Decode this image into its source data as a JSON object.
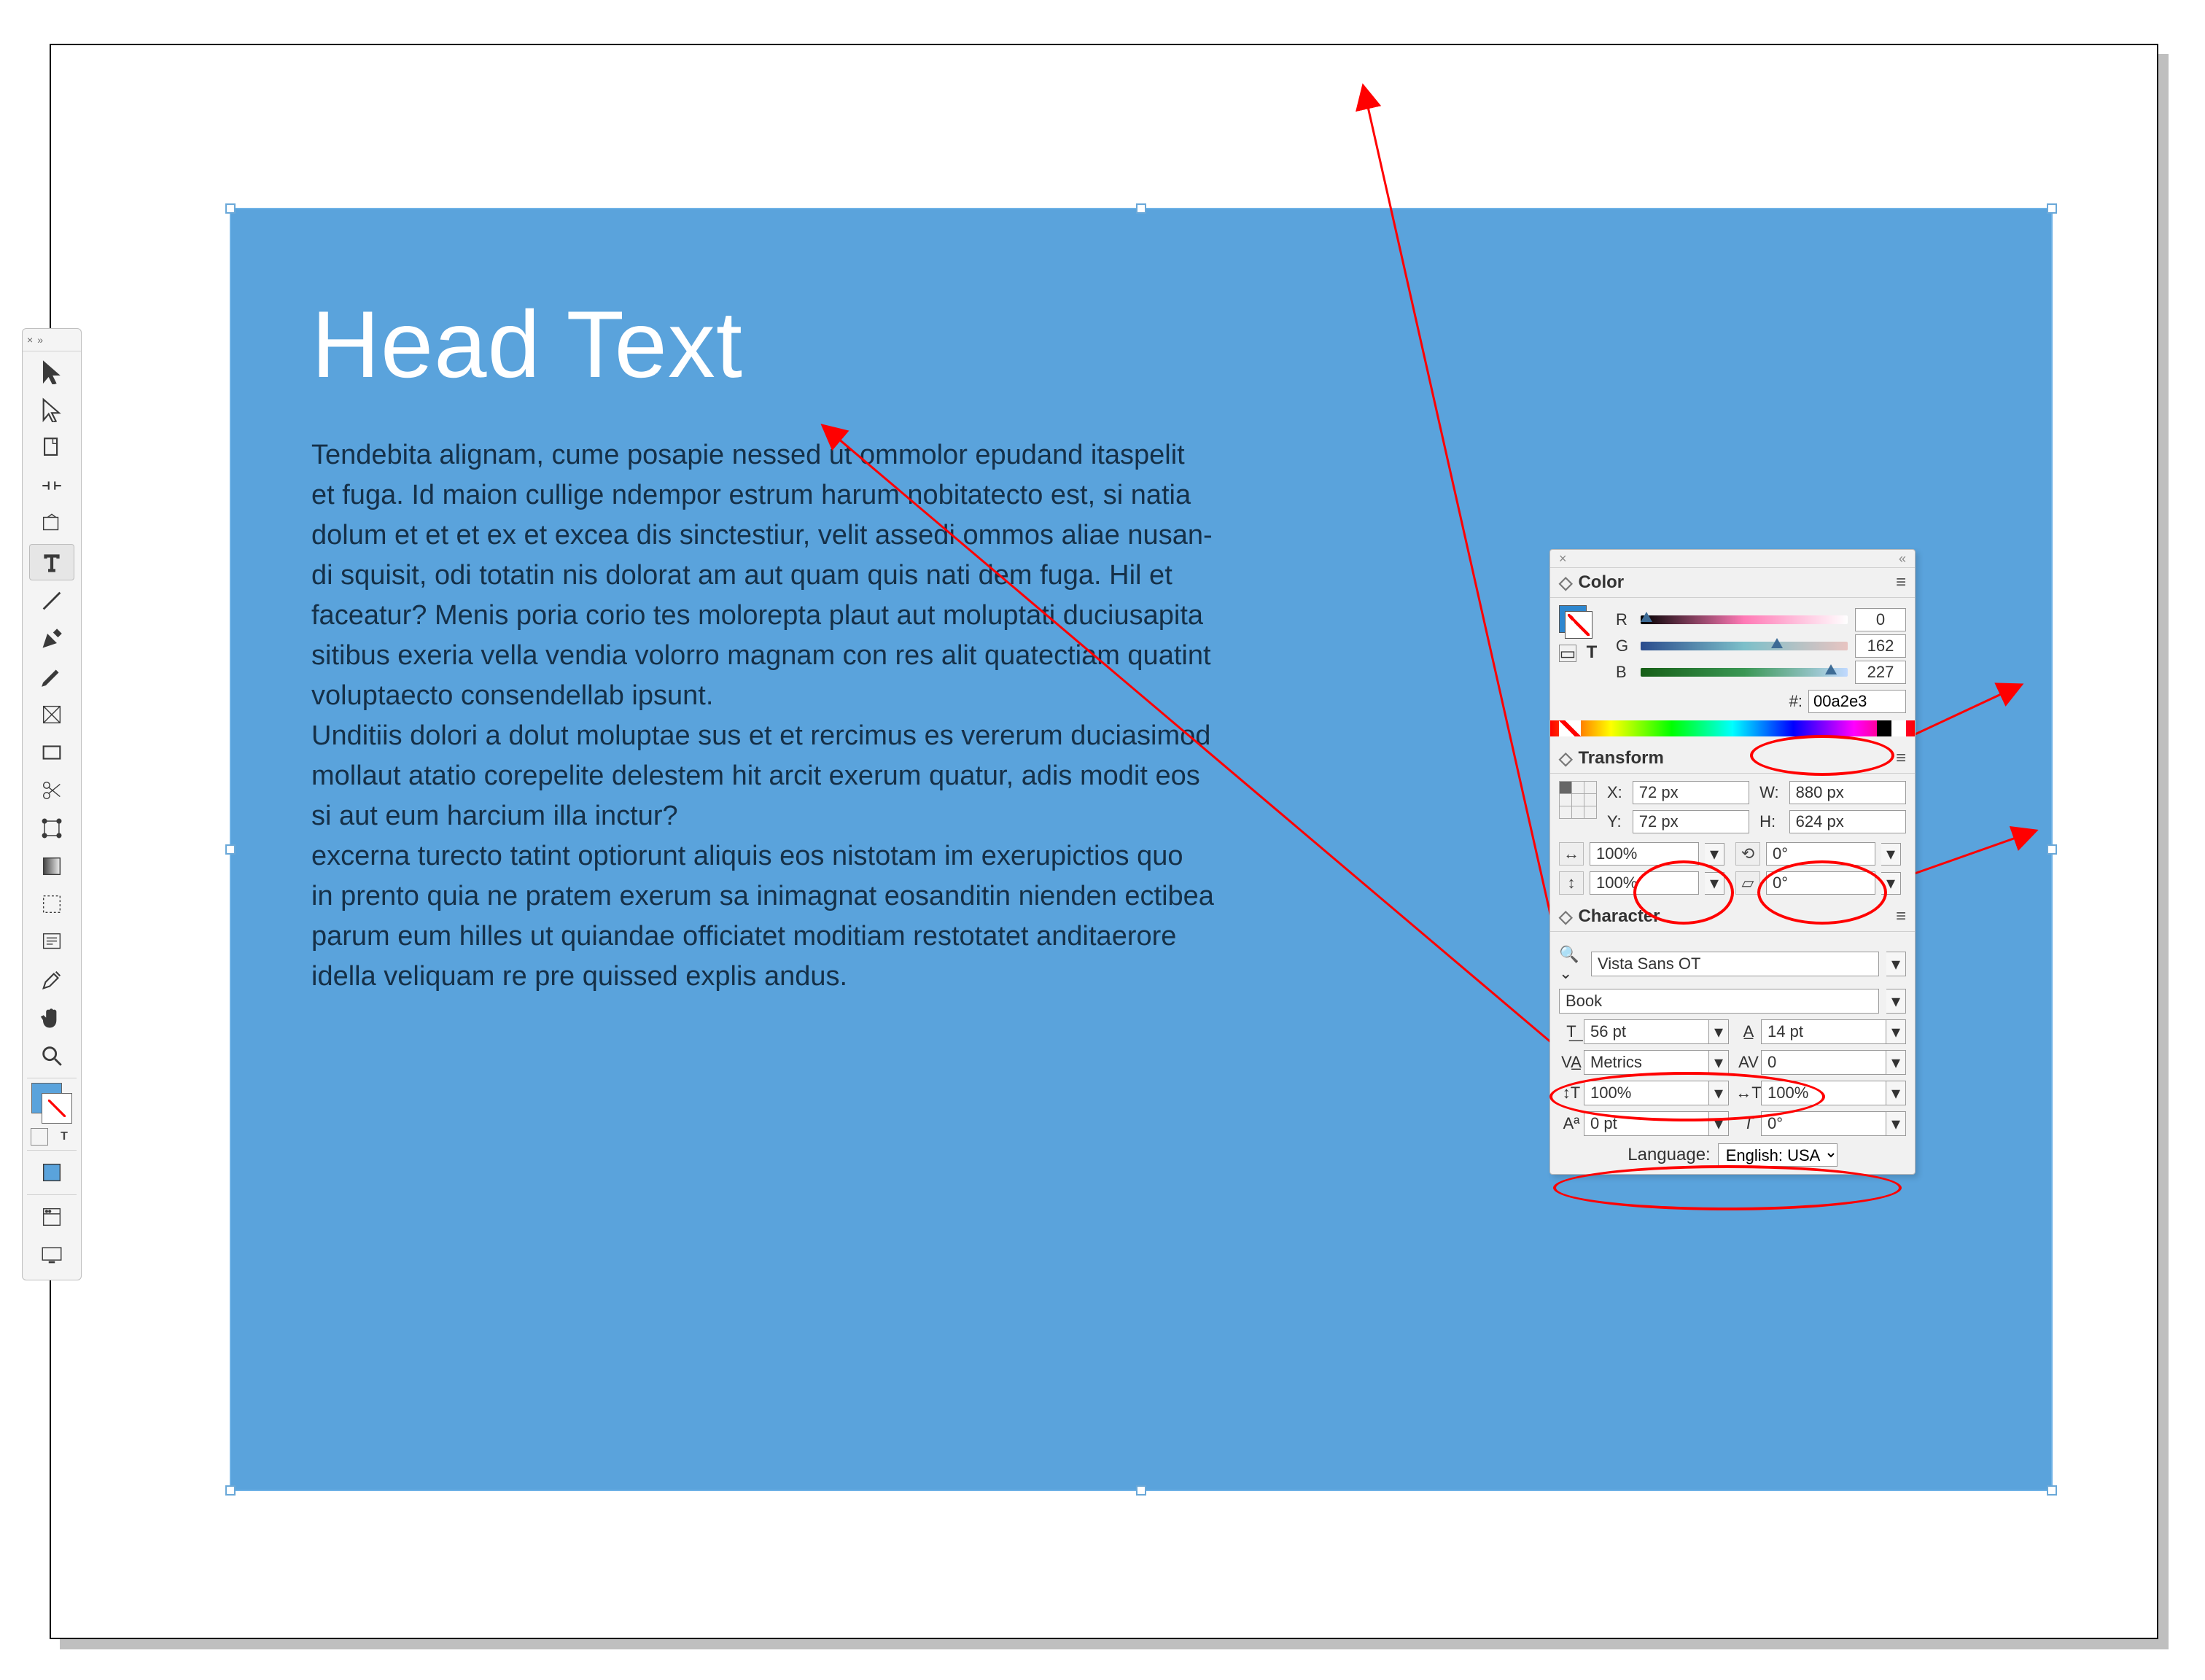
{
  "artboard": {
    "heading": "Head Text",
    "body": "Tendebita alignam, cume posapie nessed ut ommolor epudand itaspelit\net fuga. Id maion cullige ndempor estrum harum nobitatecto est, si natia\ndolum et et et ex et excea dis sinctestiur, velit assedi ommos aliae nusan-\ndi squisit, odi totatin nis dolorat am aut quam quis nati dem fuga. Hil et\nfaceatur? Menis poria corio tes molorepta plaut aut moluptati duciusapita\nsitibus exeria vella vendia volorro magnam con res alit quatectiam quatint\nvoluptaecto consendellab ipsunt.\nUnditiis dolori a dolut moluptae sus et et rercimus es vererum duciasimod\nmollaut atatio corepelite delestem hit arcit exerum quatur, adis modit eos\nsi aut eum harcium illa inctur?\nexcerna turecto tatint optiorunt aliquis eos nistotam im exerupictios quo\nin prento quia ne pratem exerum sa inimagnat eosanditin nienden ectibea\nparum eum hilles ut quiandae officiatet moditiam restotatet anditaerore\nidella veliquam re pre quissed explis andus."
  },
  "tools": {
    "close": "×",
    "expand": "»"
  },
  "color_panel": {
    "title": "Color",
    "r": "0",
    "g": "162",
    "b": "227",
    "hex_label": "#:",
    "hex": "00a2e3"
  },
  "transform_panel": {
    "title": "Transform",
    "x_label": "X:",
    "y_label": "Y:",
    "w_label": "W:",
    "h_label": "H:",
    "x": "72 px",
    "y": "72 px",
    "w": "880 px",
    "h": "624 px",
    "scale_h": "100%",
    "scale_v": "100%",
    "rotate": "0°",
    "shear": "0°"
  },
  "character_panel": {
    "title": "Character",
    "font_family": "Vista Sans OT",
    "font_style": "Book",
    "font_size": "56 pt",
    "leading": "14 pt",
    "kerning": "Metrics",
    "tracking": "0",
    "v_scale": "100%",
    "h_scale": "100%",
    "baseline": "0 pt",
    "rotation": "0°",
    "language_label": "Language:",
    "language": "English: USA"
  },
  "r_pos": "0%",
  "g_pos": "63%",
  "b_pos": "89%"
}
